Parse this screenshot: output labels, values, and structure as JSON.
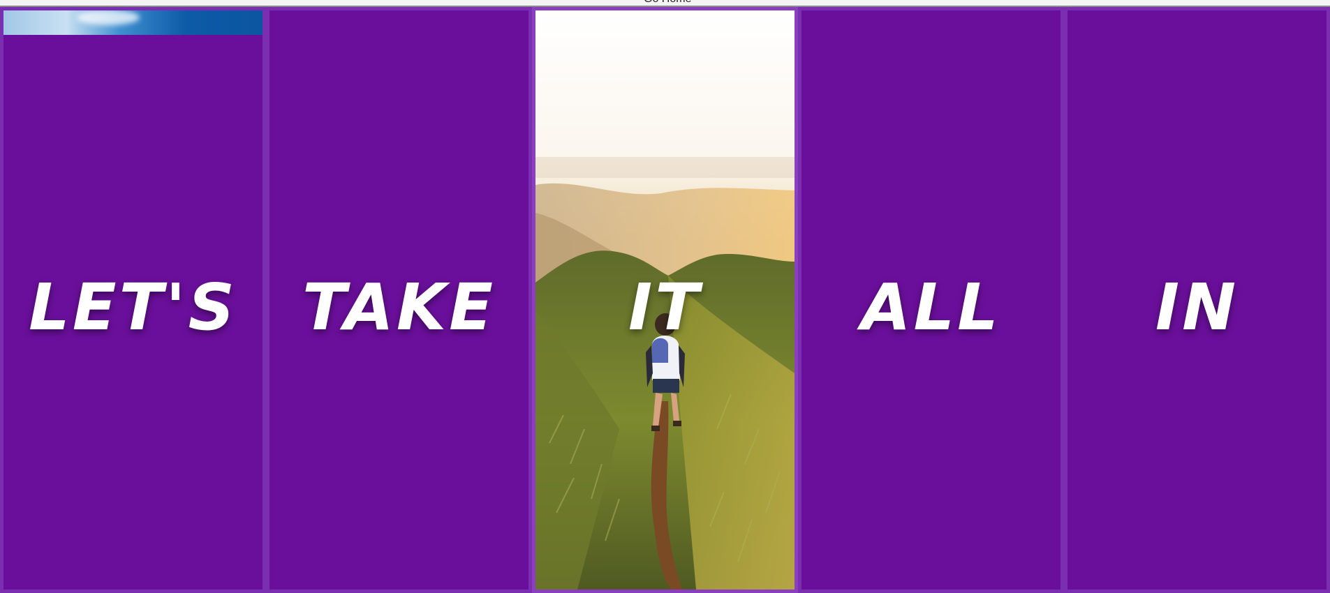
{
  "topbar": {
    "link_label": "Go Home"
  },
  "panels": [
    {
      "word": "LET'S",
      "background": "#6a0f9b",
      "has_image": false
    },
    {
      "word": "TAKE",
      "background": "#6a0f9b",
      "has_image": false
    },
    {
      "word": "IT",
      "background": "photo",
      "has_image": true
    },
    {
      "word": "ALL",
      "background": "#6a0f9b",
      "has_image": false
    },
    {
      "word": "IN",
      "background": "#6a0f9b",
      "has_image": false
    }
  ],
  "colors": {
    "panel_purple": "#6a0f9b",
    "panel_border": "#7a2fb0",
    "text": "#ffffff"
  }
}
